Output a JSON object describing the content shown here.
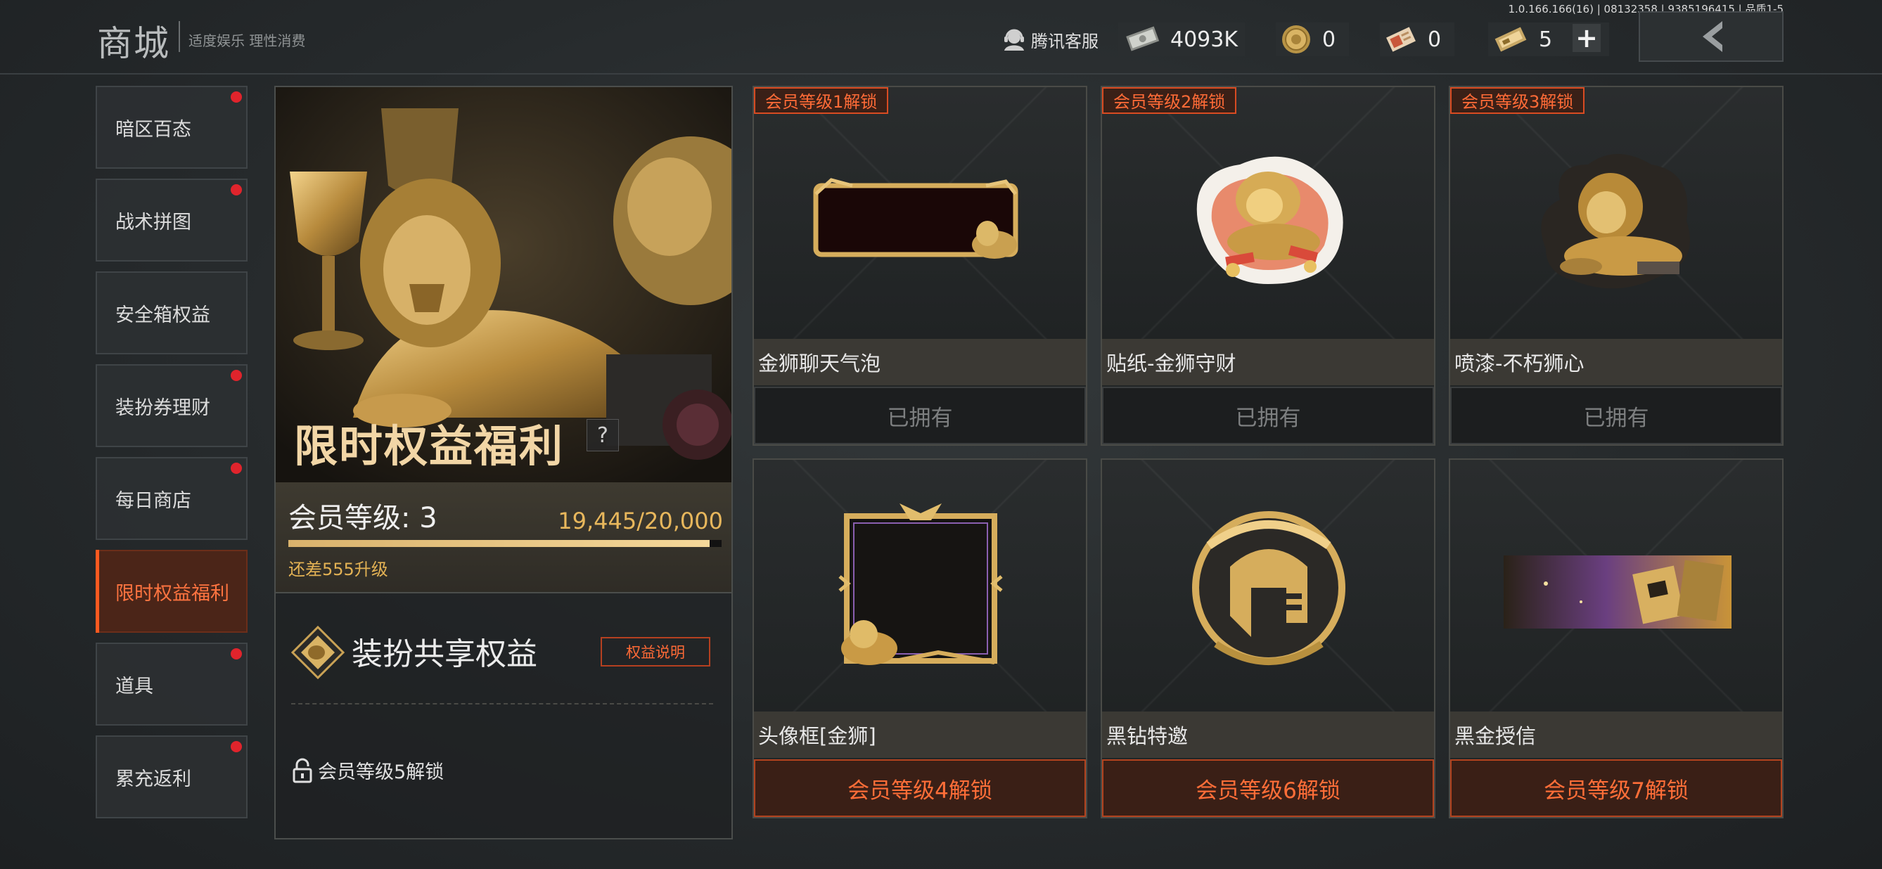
{
  "version": "1.0.166.166(16) | 08132358 | 9385196415 | 品质1-5",
  "header": {
    "title": "商城",
    "subtitle": "适度娱乐 理性消费",
    "support_label": "腾讯客服",
    "currencies": [
      {
        "icon": "cash-icon",
        "value": "4093K"
      },
      {
        "icon": "coin-icon",
        "value": "0"
      },
      {
        "icon": "ticket-icon",
        "value": "0"
      },
      {
        "icon": "voucher-icon",
        "value": "5"
      }
    ]
  },
  "sidebar": {
    "items": [
      {
        "label": "暗区百态",
        "dot": true
      },
      {
        "label": "战术拼图",
        "dot": true
      },
      {
        "label": "安全箱权益",
        "dot": false
      },
      {
        "label": "装扮券理财",
        "dot": true
      },
      {
        "label": "每日商店",
        "dot": true
      },
      {
        "label": "限时权益福利",
        "dot": false,
        "active": true
      },
      {
        "label": "道具",
        "dot": true
      },
      {
        "label": "累充返利",
        "dot": true
      }
    ]
  },
  "promo": {
    "title": "限时权益福利",
    "help": "?"
  },
  "membership": {
    "level_label": "会员等级: 3",
    "progress_text": "19,445/20,000",
    "progress_fraction": 0.97225,
    "remaining_text": "还差555升级"
  },
  "share": {
    "title": "装扮共享权益",
    "explain_button": "权益说明",
    "lock_text": "会员等级5解锁"
  },
  "cards": [
    {
      "tag": "会员等级1解锁",
      "name": "金狮聊天气泡",
      "button": "已拥有",
      "owned": true
    },
    {
      "tag": "会员等级2解锁",
      "name": "贴纸-金狮守财",
      "button": "已拥有",
      "owned": true
    },
    {
      "tag": "会员等级3解锁",
      "name": "喷漆-不朽狮心",
      "button": "已拥有",
      "owned": true
    },
    {
      "tag": "",
      "name": "头像框[金狮]",
      "button": "会员等级4解锁",
      "owned": false
    },
    {
      "tag": "",
      "name": "黑钻特邀",
      "button": "会员等级6解锁",
      "owned": false
    },
    {
      "tag": "",
      "name": "黑金授信",
      "button": "会员等级7解锁",
      "owned": false
    }
  ]
}
